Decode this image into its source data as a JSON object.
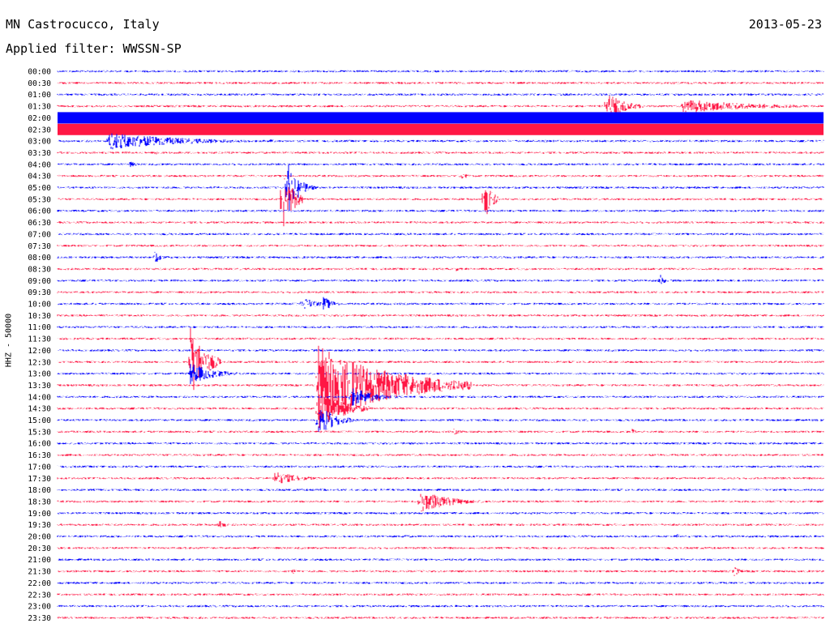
{
  "header": {
    "station": "MN Castrocucco, Italy",
    "date": "2013-05-23",
    "filter_text": "Applied filter: WWSSN-SP"
  },
  "chart_data": {
    "type": "helicorder",
    "channel_label": "HHZ - 50000",
    "trace_colors": [
      "#0000ff",
      "#ff1744"
    ],
    "row_labels": [
      "00:00",
      "00:30",
      "01:00",
      "01:30",
      "02:00",
      "02:30",
      "03:00",
      "03:30",
      "04:00",
      "04:30",
      "05:00",
      "05:30",
      "06:00",
      "06:30",
      "07:00",
      "07:30",
      "08:00",
      "08:30",
      "09:00",
      "09:30",
      "10:00",
      "10:30",
      "11:00",
      "11:30",
      "12:00",
      "12:30",
      "13:00",
      "13:30",
      "14:00",
      "14:30",
      "15:00",
      "15:30",
      "16:00",
      "16:30",
      "17:00",
      "17:30",
      "18:00",
      "18:30",
      "19:00",
      "19:30",
      "20:00",
      "20:30",
      "21:00",
      "21:30",
      "22:00",
      "22:30",
      "23:00",
      "23:30"
    ],
    "minutes_per_row": 30,
    "noise_level": 1.3,
    "saturated_rows": [
      "02:00",
      "02:30"
    ],
    "events": [
      {
        "row": "00:30",
        "minute": 18,
        "amp": 2,
        "dur": 0.5
      },
      {
        "row": "01:30",
        "minute": 21.5,
        "amp": 18,
        "dur": 1.5
      },
      {
        "row": "01:30",
        "minute": 24.5,
        "amp": 9,
        "dur": 6
      },
      {
        "row": "03:00",
        "minute": 2,
        "amp": 11,
        "dur": 6
      },
      {
        "row": "03:00",
        "minute": 8.3,
        "amp": 3,
        "dur": 0.5
      },
      {
        "row": "03:30",
        "minute": 3.8,
        "amp": 3,
        "dur": 0.8
      },
      {
        "row": "04:00",
        "minute": 2.8,
        "amp": 4,
        "dur": 0.8
      },
      {
        "row": "04:30",
        "minute": 15.8,
        "amp": 6,
        "dur": 0.5
      },
      {
        "row": "05:00",
        "minute": 9,
        "amp": 40,
        "dur": 0.6
      },
      {
        "row": "05:00",
        "minute": 9.4,
        "amp": 14,
        "dur": 0.8
      },
      {
        "row": "05:30",
        "minute": 8.8,
        "amp": 45,
        "dur": 0.8
      },
      {
        "row": "05:30",
        "minute": 16.7,
        "amp": 30,
        "dur": 0.6
      },
      {
        "row": "08:00",
        "minute": 3.8,
        "amp": 9,
        "dur": 0.5
      },
      {
        "row": "08:30",
        "minute": 15.6,
        "amp": 3,
        "dur": 0.5
      },
      {
        "row": "09:00",
        "minute": 23.6,
        "amp": 8,
        "dur": 0.4
      },
      {
        "row": "10:00",
        "minute": 9.6,
        "amp": 9,
        "dur": 1.2
      },
      {
        "row": "10:00",
        "minute": 10.4,
        "amp": 10,
        "dur": 0.8
      },
      {
        "row": "12:30",
        "minute": 5.2,
        "amp": 45,
        "dur": 1.2
      },
      {
        "row": "13:00",
        "minute": 5.2,
        "amp": 14,
        "dur": 2
      },
      {
        "row": "13:30",
        "minute": 10.2,
        "amp": 50,
        "dur": 6
      },
      {
        "row": "14:00",
        "minute": 11.5,
        "amp": 12,
        "dur": 2
      },
      {
        "row": "14:30",
        "minute": 10.2,
        "amp": 28,
        "dur": 2
      },
      {
        "row": "15:00",
        "minute": 10.2,
        "amp": 20,
        "dur": 1.5
      },
      {
        "row": "15:30",
        "minute": 15.5,
        "amp": 4,
        "dur": 0.8
      },
      {
        "row": "15:30",
        "minute": 22.5,
        "amp": 4,
        "dur": 0.4
      },
      {
        "row": "17:30",
        "minute": 8.5,
        "amp": 9,
        "dur": 2
      },
      {
        "row": "18:30",
        "minute": 14.2,
        "amp": 14,
        "dur": 2.5
      },
      {
        "row": "19:30",
        "minute": 6.3,
        "amp": 8,
        "dur": 0.5
      },
      {
        "row": "20:00",
        "minute": 13.5,
        "amp": 3,
        "dur": 1
      },
      {
        "row": "20:00",
        "minute": 24.2,
        "amp": 5,
        "dur": 0.4
      },
      {
        "row": "21:30",
        "minute": 9.2,
        "amp": 4,
        "dur": 0.4
      },
      {
        "row": "21:30",
        "minute": 26.5,
        "amp": 7,
        "dur": 0.5
      }
    ]
  }
}
